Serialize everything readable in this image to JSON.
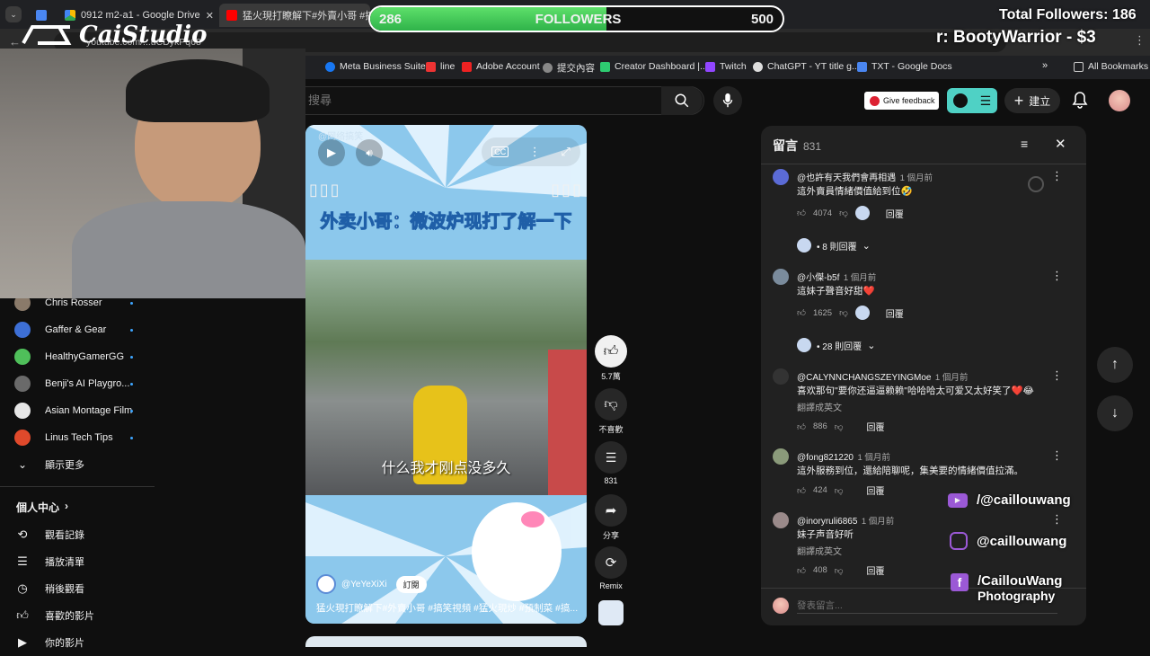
{
  "tabs": [
    {
      "label": ""
    },
    {
      "label": "0912 m2-a1 - Google Drive"
    },
    {
      "label": "猛火現打瞭解下#外賣小哥 #搞"
    }
  ],
  "address": {
    "url": "youtube.com/...uCDykPq68"
  },
  "bookmarks": [
    "Meta Business Suite",
    "line",
    "Adobe Account",
    "提交內容",
    "Creator Dashboard |...",
    "Twitch",
    "ChatGPT - YT title g...",
    "TXT - Google Docs"
  ],
  "all_bookmarks": "All Bookmarks",
  "header": {
    "search_placeholder": "搜尋",
    "feedback": "Give feedback",
    "create": "建立"
  },
  "sidebar": {
    "subscriptions": [
      {
        "name": "Chris Rosser",
        "color": "#8a7a6a"
      },
      {
        "name": "Gaffer & Gear",
        "color": "#3d6fd6"
      },
      {
        "name": "HealthyGamerGG",
        "color": "#4fbf5a"
      },
      {
        "name": "Benji's AI Playgro...",
        "color": "#6a6a6a"
      },
      {
        "name": "Asian Montage Film",
        "color": "#e6e6e6"
      },
      {
        "name": "Linus Tech Tips",
        "color": "#e0492b"
      }
    ],
    "show_more": "顯示更多",
    "you_heading": "個人中心",
    "you_items": [
      "觀看記錄",
      "播放清單",
      "稍後觀看",
      "喜歡的影片",
      "你的影片"
    ]
  },
  "video": {
    "banner_text": "外卖小哥：微波炉现打了解一下",
    "watermark": "@网络搞笑",
    "subtitle": "什么我才刚点没多久",
    "channel": "@YeYeXiXi",
    "subscribe": "訂閱",
    "title": "猛火現打瞭解下#外賣小哥 #搞笑視頻 #猛火現炒 #預制菜 #搞..."
  },
  "actions": {
    "likes": "5.7萬",
    "dislike": "不喜歡",
    "comments": "831",
    "share": "分享",
    "remix": "Remix"
  },
  "comments_panel": {
    "title": "留言",
    "count": "831",
    "add_placeholder": "發表留言...",
    "items": [
      {
        "user": "@也許有天我們會再相遇",
        "time": "1 個月前",
        "text": "這外賣員情緒價值給到位🤣",
        "likes": "4074",
        "reply": "回覆",
        "replies": "• 8 則回覆",
        "translate": "",
        "avatar": "#5b6bd6"
      },
      {
        "user": "@小傑-b5f",
        "time": "1 個月前",
        "text": "這妹子聲音好甜❤️",
        "likes": "1625",
        "reply": "回覆",
        "replies": "• 28 則回覆",
        "translate": "",
        "avatar": "#7a8b9c"
      },
      {
        "user": "@CALYNNCHANGSZEYINGMoe",
        "time": "1 個月前",
        "text": "喜欢那句\"要你还逼逼赖赖\"哈哈哈太可爱又太好笑了❤️😂",
        "likes": "886",
        "reply": "回覆",
        "replies": "",
        "translate": "翻譯成英文",
        "avatar": "#333333"
      },
      {
        "user": "@fong821220",
        "time": "1 個月前",
        "text": "這外服務到位，還給陪聊呢，集美要的情緒價值拉滿。",
        "likes": "424",
        "reply": "回覆",
        "replies": "",
        "translate": "",
        "avatar": "#8a9a7a"
      },
      {
        "user": "@inoryruli6865",
        "time": "1 個月前",
        "text": "妹子声音好听",
        "likes": "408",
        "reply": "回覆",
        "replies": "",
        "translate": "翻譯成英文",
        "avatar": "#9a8a8a"
      }
    ]
  },
  "overlay": {
    "logo": "CaiStudio",
    "followers_current": "286",
    "followers_label": "FOLLOWERS",
    "followers_goal": "500",
    "followers_progress": 0.572,
    "total_followers": "Total Followers: 186",
    "donation": "r: BootyWarrior - $3",
    "youtube": "/@caillouwang",
    "instagram": "@caillouwang",
    "facebook_1": "/CaillouWang",
    "facebook_2": "Photography"
  },
  "colors": {
    "youtube_red": "#ff0000",
    "accent_teal": "#4fd1c5",
    "progress_green": "#3cc95a",
    "link_blue": "#3ea6ff"
  }
}
